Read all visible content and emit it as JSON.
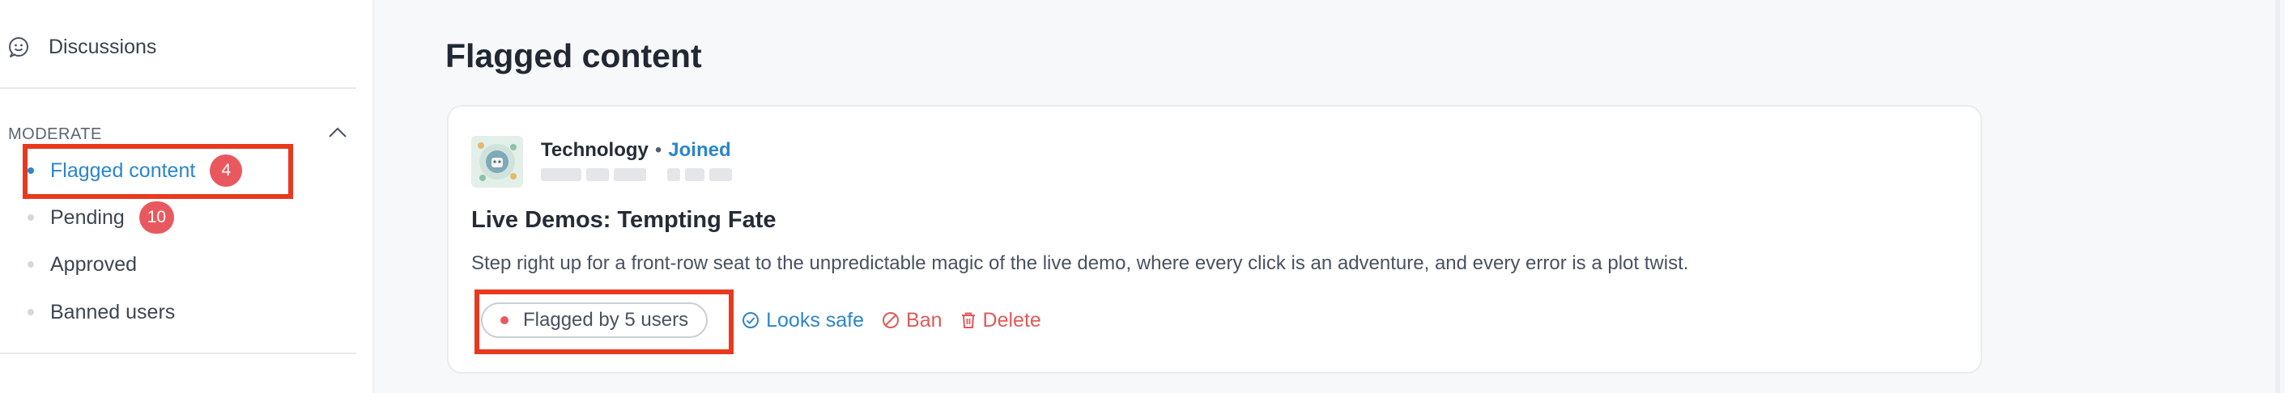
{
  "sidebar": {
    "discussions_label": "Discussions",
    "section_title": "MODERATE",
    "items": [
      {
        "label": "Flagged content",
        "count": "4",
        "active": true
      },
      {
        "label": "Pending",
        "count": "10",
        "active": false
      },
      {
        "label": "Approved",
        "count": null,
        "active": false
      },
      {
        "label": "Banned users",
        "count": null,
        "active": false
      }
    ]
  },
  "main": {
    "page_title": "Flagged content",
    "card": {
      "community": "Technology",
      "separator": "•",
      "membership": "Joined",
      "post_title": "Live Demos: Tempting Fate",
      "post_body": "Step right up for a front-row seat to the unpredictable magic of the live demo, where every click is an adventure, and every error is a plot twist.",
      "flag_label": "Flagged by 5 users",
      "actions": {
        "safe": "Looks safe",
        "ban": "Ban",
        "delete": "Delete"
      }
    }
  },
  "colors": {
    "accent": "#2a86c9",
    "danger": "#e05a5a",
    "badge": "#e8595f",
    "highlight": "#e8391f"
  },
  "icons": {
    "discussions": "chat-bubble-icon",
    "collapse": "chevron-up-icon",
    "safe": "check-circle-icon",
    "ban": "ban-icon",
    "delete": "trash-icon"
  }
}
